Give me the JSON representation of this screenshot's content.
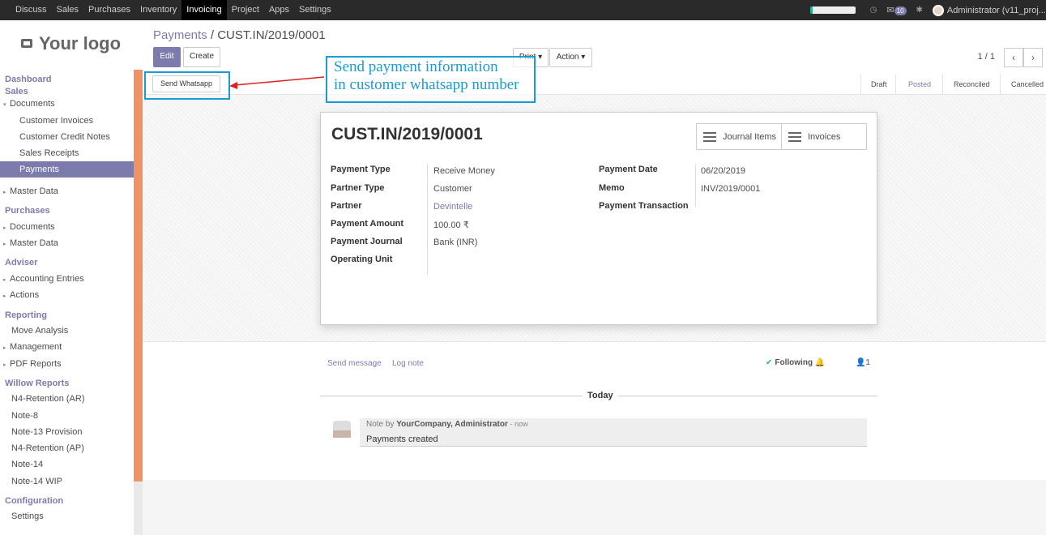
{
  "topbar": {
    "menu": [
      "Discuss",
      "Sales",
      "Purchases",
      "Inventory",
      "Invoicing",
      "Project",
      "Apps",
      "Settings"
    ],
    "active_menu": "Invoicing",
    "messages_count": "10",
    "user": "Administrator (v11_proj..."
  },
  "sidebar": {
    "logo": "Your logo",
    "items": [
      {
        "label": "Dashboard",
        "kind": "head"
      },
      {
        "label": "Sales",
        "kind": "head"
      },
      {
        "label": "Documents",
        "kind": "group"
      },
      {
        "label": "Customer Invoices",
        "kind": "sub"
      },
      {
        "label": "Customer Credit Notes",
        "kind": "sub"
      },
      {
        "label": "Sales Receipts",
        "kind": "sub"
      },
      {
        "label": "Payments",
        "kind": "sub",
        "selected": true
      },
      {
        "label": "Master Data",
        "kind": "group"
      },
      {
        "label": "Purchases",
        "kind": "head"
      },
      {
        "label": "Documents",
        "kind": "group"
      },
      {
        "label": "Master Data",
        "kind": "group"
      },
      {
        "label": "Adviser",
        "kind": "head"
      },
      {
        "label": "Accounting Entries",
        "kind": "group"
      },
      {
        "label": "Actions",
        "kind": "group"
      },
      {
        "label": "Reporting",
        "kind": "head"
      },
      {
        "label": "Move Analysis",
        "kind": "item"
      },
      {
        "label": "Management",
        "kind": "group"
      },
      {
        "label": "PDF Reports",
        "kind": "group"
      },
      {
        "label": "Willow Reports",
        "kind": "head"
      },
      {
        "label": "N4-Retention (AR)",
        "kind": "item"
      },
      {
        "label": "Note-8",
        "kind": "item"
      },
      {
        "label": "Note-13 Provision",
        "kind": "item"
      },
      {
        "label": "N4-Retention (AP)",
        "kind": "item"
      },
      {
        "label": "Note-14",
        "kind": "item"
      },
      {
        "label": "Note-14 WIP",
        "kind": "item"
      },
      {
        "label": "Configuration",
        "kind": "head"
      },
      {
        "label": "Settings",
        "kind": "item"
      }
    ]
  },
  "breadcrumb": {
    "parent": "Payments",
    "separator": "/",
    "current": "CUST.IN/2019/0001"
  },
  "controls": {
    "edit": "Edit",
    "create": "Create",
    "print": "Print",
    "action": "Action",
    "pager": "1 / 1",
    "send_whatsapp": "Send Whatsapp"
  },
  "statusbar": [
    "Draft",
    "Posted",
    "Reconciled",
    "Cancelled"
  ],
  "active_status": "Posted",
  "record": {
    "title": "CUST.IN/2019/0001",
    "smart_buttons": [
      "Journal Items",
      "Invoices"
    ],
    "left_fields": [
      {
        "label": "Payment Type",
        "value": "Receive Money"
      },
      {
        "label": "Partner Type",
        "value": "Customer"
      },
      {
        "label": "Partner",
        "value": "Devintelle"
      },
      {
        "label": "Payment Amount",
        "value": "100.00 ₹"
      },
      {
        "label": "Payment Journal",
        "value": "Bank (INR)"
      },
      {
        "label": "Operating Unit",
        "value": ""
      }
    ],
    "right_fields": [
      {
        "label": "Payment Date",
        "value": "06/20/2019"
      },
      {
        "label": "Memo",
        "value": "INV/2019/0001"
      },
      {
        "label": "Payment Transaction",
        "value": ""
      }
    ]
  },
  "chatter": {
    "send_message": "Send message",
    "log_note": "Log note",
    "following": "Following",
    "followers": "1",
    "separator": "Today",
    "message": {
      "prefix": "Note by",
      "author": "YourCompany, Administrator",
      "time": "- now",
      "body": "Payments created"
    }
  },
  "annotation": {
    "text_line1": "Send payment information",
    "text_line2": "in customer whatsapp number",
    "color": "#1b9ad6",
    "arrow_color": "#e02020"
  }
}
